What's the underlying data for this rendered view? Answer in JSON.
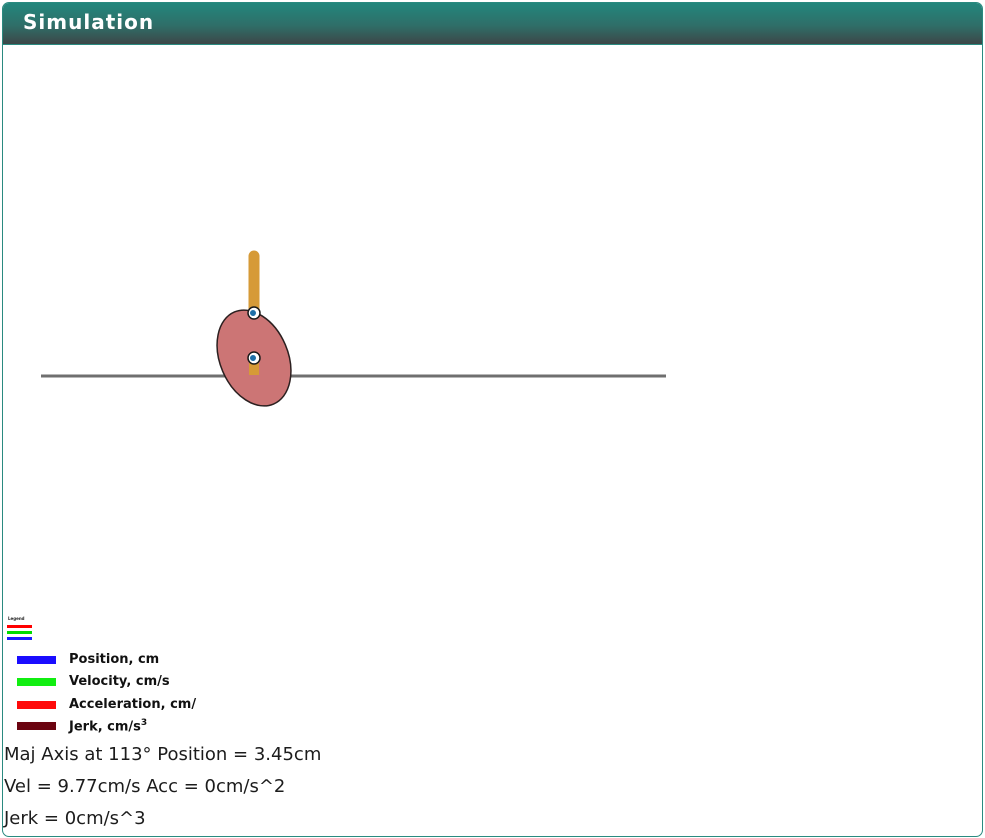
{
  "panel": {
    "title": "Simulation"
  },
  "simulation": {
    "colors": {
      "ground_line": "#6f6f6f",
      "follower_rod": "#d69a37",
      "cam_fill": "#cc7575",
      "cam_stroke": "#2b2020",
      "pivot": "#1d6fa8"
    }
  },
  "legend_mini": {
    "title": "Legend",
    "colors": [
      "#ff0000",
      "#00dd00",
      "#1a1aff"
    ]
  },
  "legend": {
    "items": [
      {
        "label": "Position, cm",
        "color": "#1a0dff"
      },
      {
        "label": "Velocity, cm/s",
        "color": "#11ee11"
      },
      {
        "label": "Acceleration, cm/",
        "color": "#ff0a0a"
      },
      {
        "label": "Jerk, cm/s",
        "sup": "3",
        "color": "#6b0410"
      }
    ]
  },
  "readouts": {
    "line1": "Maj Axis at 113° Position = 3.45cm",
    "line2": "Vel = 9.77cm/s Acc = 0cm/s^2",
    "line3": "Jerk = 0cm/s^3"
  }
}
